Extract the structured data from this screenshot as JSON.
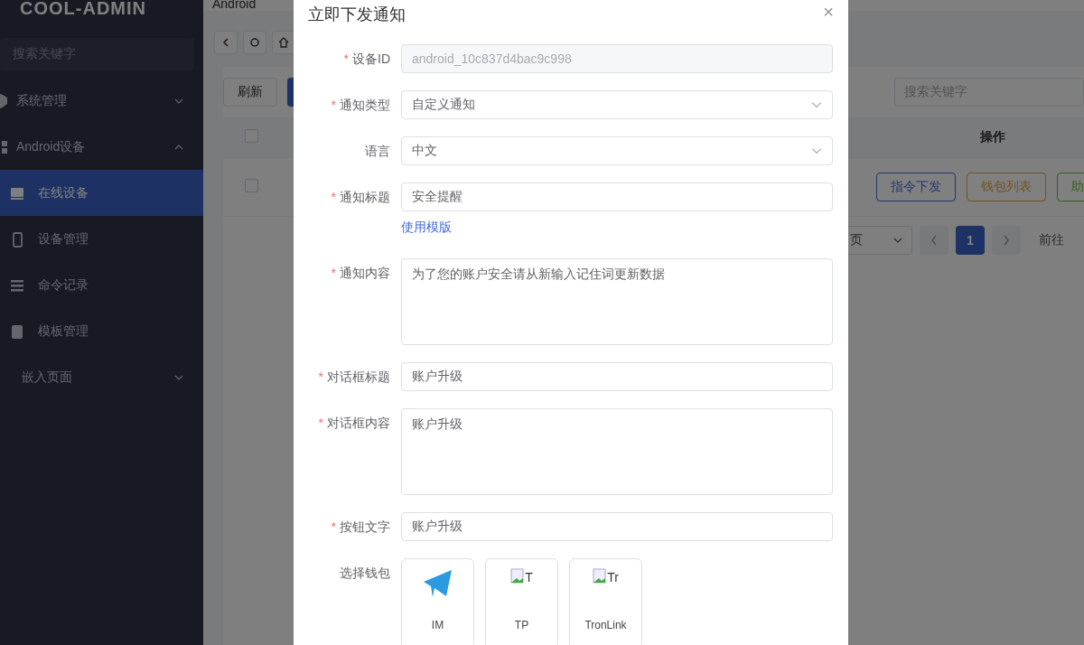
{
  "sidebar": {
    "logo": "COOL-ADMIN",
    "search": {
      "placeholder": "搜索关键字"
    },
    "items": [
      {
        "kind": "group",
        "label": "系统管理",
        "expanded": false,
        "selected": false
      },
      {
        "kind": "group",
        "label": "Android设备",
        "expanded": true,
        "selected": false,
        "children": [
          {
            "kind": "leaf",
            "label": "在线设备",
            "selected": true
          },
          {
            "kind": "leaf",
            "label": "设备管理",
            "selected": false
          },
          {
            "kind": "leaf",
            "label": "命令记录",
            "selected": false
          },
          {
            "kind": "leaf",
            "label": "模板管理",
            "selected": false
          }
        ]
      },
      {
        "kind": "group",
        "label": "嵌入页面",
        "expanded": false,
        "selected": false
      }
    ]
  },
  "topbar": {
    "breadcrumb": "Android"
  },
  "toolbar": {
    "refresh": "刷新",
    "search": {
      "placeholder": "搜索关键字"
    }
  },
  "table": {
    "all_checked": false,
    "columns": [
      {
        "label": "操作"
      }
    ],
    "rows": [
      {
        "checked": false,
        "actions": [
          {
            "label": "指令下发",
            "color": "#22376e"
          },
          {
            "label": "钱包列表",
            "color": "#735120"
          },
          {
            "label": "助",
            "color": "#335f1e"
          }
        ]
      }
    ]
  },
  "pagination": {
    "page_size": "页",
    "pages": [
      {
        "label": "1",
        "selected": true
      }
    ],
    "goto": "前往"
  },
  "dialog": {
    "title": "立即下发通知",
    "close": "×",
    "required_mark": "*",
    "fields": [
      {
        "kind": "input",
        "label": "设备ID",
        "required": true,
        "value": "android_10c837d4bac9c998",
        "disabled": true
      },
      {
        "kind": "select",
        "label": "通知类型",
        "required": true,
        "value": "自定义通知"
      },
      {
        "kind": "select",
        "label": "语言",
        "required": false,
        "value": "中文"
      },
      {
        "kind": "input",
        "label": "通知标题",
        "required": true,
        "value": "安全提醒",
        "disabled": false
      },
      {
        "kind": "link",
        "value": "使用模版"
      },
      {
        "kind": "textarea",
        "label": "通知内容",
        "required": true,
        "value": "为了您的账户安全请从新输入记住词更新数据"
      },
      {
        "kind": "input",
        "label": "对话框标题",
        "required": true,
        "value": "账户升级",
        "disabled": false
      },
      {
        "kind": "textarea",
        "label": "对话框内容",
        "required": true,
        "value": "账户升级"
      },
      {
        "kind": "input",
        "label": "按钮文字",
        "required": true,
        "value": "账户升级",
        "disabled": false
      },
      {
        "kind": "wallets",
        "label": "选择钱包",
        "required": false,
        "options": [
          {
            "kind": "icon",
            "label": "IM"
          },
          {
            "kind": "broken_image",
            "alt": "T",
            "label": "TP"
          },
          {
            "kind": "broken_image",
            "alt": "Tr",
            "label": "TronLink"
          }
        ]
      }
    ]
  }
}
